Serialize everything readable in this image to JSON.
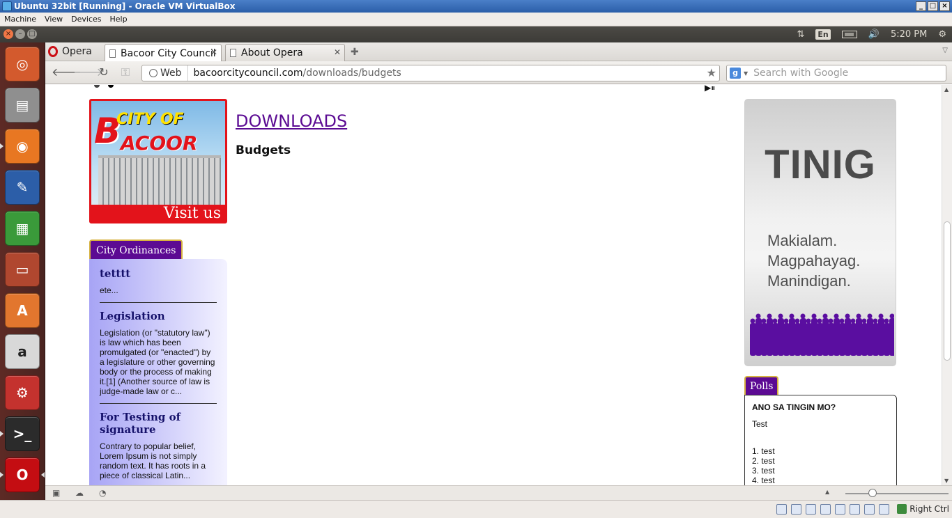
{
  "vbox": {
    "title": "Ubuntu 32bit [Running] - Oracle VM VirtualBox",
    "menu": [
      "Machine",
      "View",
      "Devices",
      "Help"
    ],
    "host_key": "Right Ctrl"
  },
  "ubuntu_panel": {
    "keyboard_layout": "En",
    "clock": "5:20 PM"
  },
  "launcher": {
    "items": [
      {
        "name": "dash-home-icon",
        "bg": "#d35a2d"
      },
      {
        "name": "files-icon",
        "bg": "#8f8f8f"
      },
      {
        "name": "firefox-icon",
        "bg": "#e87722"
      },
      {
        "name": "libreoffice-writer-icon",
        "bg": "#2c5ea8"
      },
      {
        "name": "libreoffice-calc-icon",
        "bg": "#3a9a3a"
      },
      {
        "name": "libreoffice-impress-icon",
        "bg": "#b0472f"
      },
      {
        "name": "ubuntu-software-center-icon",
        "bg": "#e2762e"
      },
      {
        "name": "amazon-icon",
        "bg": "#d8d8d8"
      },
      {
        "name": "system-settings-icon",
        "bg": "#c4322e"
      },
      {
        "name": "terminal-icon",
        "bg": "#2b2b2b"
      },
      {
        "name": "opera-icon",
        "bg": "#c40d12"
      }
    ]
  },
  "browser": {
    "menu_label": "Opera",
    "tabs": [
      {
        "label": "Bacoor City Council",
        "active": true
      },
      {
        "label": "About Opera",
        "active": false
      }
    ],
    "address": {
      "badge": "Web",
      "host": "bacoorcitycouncil.com",
      "path": "/downloads/budgets"
    },
    "search": {
      "placeholder": "Search with Google"
    }
  },
  "page": {
    "banner": {
      "line1": "CITY OF",
      "big_letter": "B",
      "line2": "ACOOR",
      "cta": "Visit us"
    },
    "heading": "DOWNLOADS",
    "subheading": "Budgets",
    "ordinances": {
      "tab": "City Ordinances",
      "items": [
        {
          "title": "tetttt",
          "excerpt": "ete..."
        },
        {
          "title": "Legislation",
          "excerpt": "Legislation (or \"statutory law\") is law which has been promulgated (or \"enacted\") by a legislature or other governing body or the process of making it.[1] (Another source of law is judge-made law or c..."
        },
        {
          "title": "For Testing of signature",
          "excerpt": "Contrary to popular belief, Lorem Ipsum is not simply random text. It has roots in a piece of classical Latin..."
        }
      ]
    },
    "ad": {
      "title": "TINIG",
      "lines": [
        "Makialam.",
        "Magpahayag.",
        "Manindigan."
      ]
    },
    "polls": {
      "tab": "Polls",
      "question": "ANO SA TINGIN MO?",
      "description": "Test",
      "options": [
        "1. test",
        "2. test",
        "3. test",
        "4. test"
      ]
    }
  },
  "colors": {
    "accent_purple": "#5c0a93",
    "link": "#5b0b93",
    "banner_red": "#e3131b"
  }
}
